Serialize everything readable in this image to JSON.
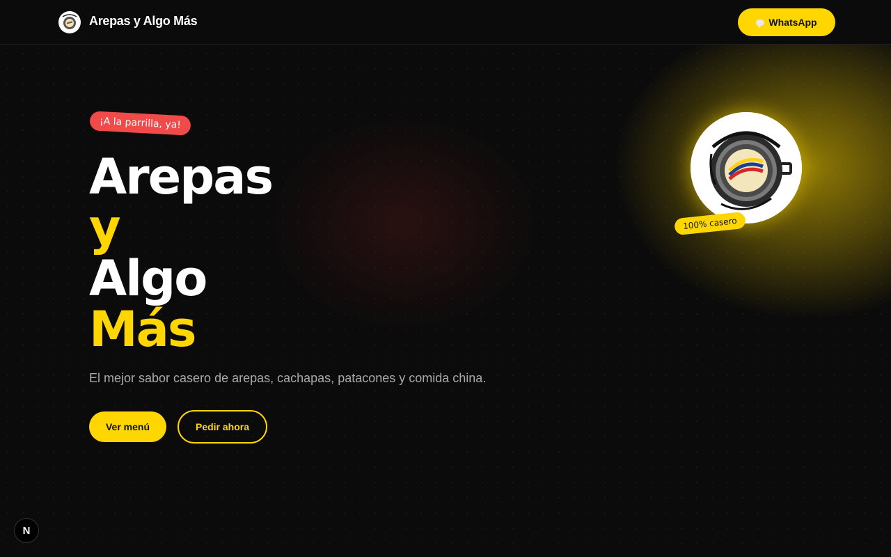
{
  "header": {
    "brand_name": "Arepas y Algo Más",
    "whatsapp_label": "WhatsApp"
  },
  "hero": {
    "tag": "¡A la parrilla, ya!",
    "title_lines": [
      "Arepas",
      "y",
      "Algo",
      "Más"
    ],
    "subtitle": "El mejor sabor casero de arepas, cachapas, patacones y comida china.",
    "menu_button": "Ver menú",
    "order_button": "Pedir ahora"
  },
  "logo_badge": {
    "badge": "100% casero"
  },
  "dev_indicator": {
    "label": "N"
  },
  "colors": {
    "background": "#0b0b0b",
    "accent": "#ffd600",
    "tag": "#f04a4a",
    "subtitle": "#a9a9a9"
  }
}
